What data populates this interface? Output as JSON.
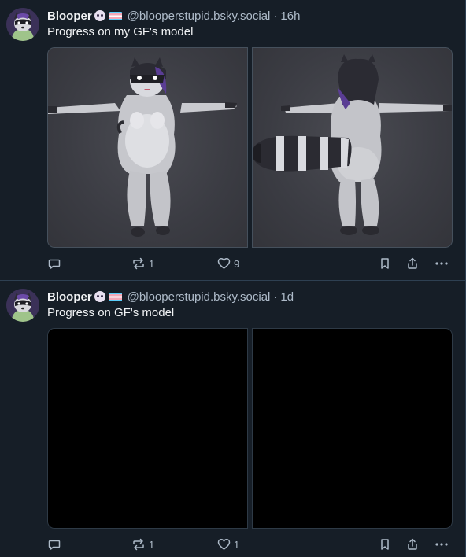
{
  "posts": [
    {
      "author": {
        "display_name": "Blooper",
        "emoji_icon": "raccoon-face-icon",
        "flag_icon": "trans-flag-icon",
        "handle": "@blooperstupid.bsky.social"
      },
      "separator": "·",
      "time": "16h",
      "text": "Progress on my GF's model",
      "images": [
        "raccoon model front view",
        "raccoon model back view"
      ],
      "actions": {
        "reply_count": "",
        "repost_count": "1",
        "like_count": "9"
      }
    },
    {
      "author": {
        "display_name": "Blooper",
        "emoji_icon": "raccoon-face-icon",
        "flag_icon": "trans-flag-icon",
        "handle": "@blooperstupid.bsky.social"
      },
      "separator": "·",
      "time": "1d",
      "text": "Progress on GF's model",
      "images": [
        "black image",
        "black image"
      ],
      "actions": {
        "reply_count": "",
        "repost_count": "1",
        "like_count": "1"
      }
    }
  ],
  "colors": {
    "background": "#161e27",
    "text_primary": "#f1f3f5",
    "text_secondary": "#aebbc9",
    "divider": "#2e4052"
  }
}
